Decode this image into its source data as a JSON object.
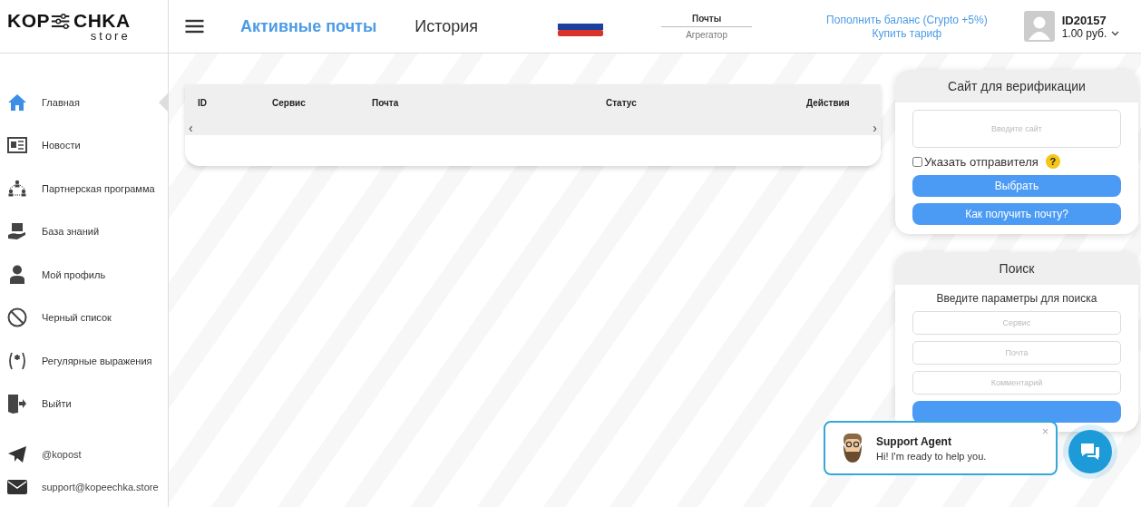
{
  "logo": {
    "left": "KOP",
    "right": "CHKA",
    "sub": "store"
  },
  "nav_tabs": [
    {
      "label": "Активные почты",
      "selected": true
    },
    {
      "label": "История",
      "selected": false
    }
  ],
  "mode_switch": {
    "top": "Почты",
    "bottom": "Агрегатор"
  },
  "balance_links": [
    "Пополнить баланс (Crypto +5%)",
    "Купить тариф"
  ],
  "account": {
    "id": "ID20157",
    "balance": "1.00 руб."
  },
  "sidebar": {
    "items": [
      {
        "label": "Главная",
        "selected": true
      },
      {
        "label": "Новости",
        "selected": false
      },
      {
        "label": "Партнерская программа",
        "selected": false
      },
      {
        "label": "База знаний",
        "selected": false
      },
      {
        "label": "Мой профиль",
        "selected": false
      },
      {
        "label": "Черный список",
        "selected": false
      },
      {
        "label": "Регулярные выражения",
        "selected": false
      },
      {
        "label": "Выйти",
        "selected": false
      }
    ],
    "contacts": [
      "@kopost",
      "support@kopeechka.store"
    ]
  },
  "table": {
    "columns": [
      "ID",
      "Сервис",
      "Почта",
      "Статус",
      "Действия"
    ],
    "scroll_left": "‹",
    "scroll_right": "›"
  },
  "verification": {
    "title": "Сайт для верификации",
    "site_placeholder": "Введите сайт",
    "sender_checkbox": {
      "label": "Указать отправителя",
      "checked": false
    },
    "help": "?",
    "buttons": [
      "Выбрать",
      "Как получить почту?"
    ]
  },
  "search": {
    "title": "Поиск",
    "hint": "Введите параметры для поиска",
    "fields": [
      {
        "placeholder": "Сервис"
      },
      {
        "placeholder": "Почта"
      },
      {
        "placeholder": "Комментарий"
      }
    ]
  },
  "chat": {
    "agent": "Support Agent",
    "message": "Hi! I'm ready to help you.",
    "close": "×"
  }
}
